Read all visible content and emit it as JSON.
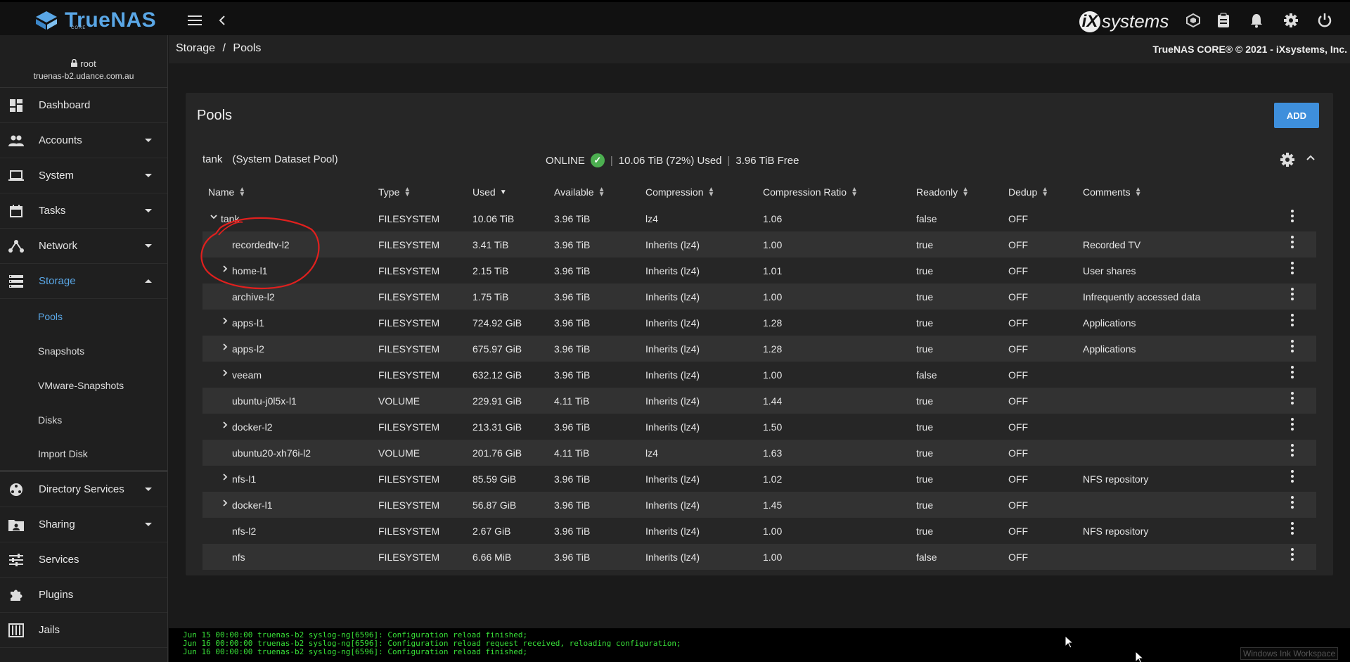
{
  "topbar": {
    "logo_text": "TrueNAS",
    "logo_sub": "CORE",
    "brand_text": "systems",
    "icons": [
      "menu-icon",
      "back-arrow-icon",
      "truecommand-icon",
      "clipboard-icon",
      "bell-icon",
      "gear-icon",
      "power-icon"
    ]
  },
  "user": {
    "name": "root",
    "host": "truenas-b2.udance.com.au"
  },
  "sidebar": {
    "items": [
      {
        "label": "Dashboard",
        "icon": "dashboard-icon",
        "caret": false
      },
      {
        "label": "Accounts",
        "icon": "accounts-icon",
        "caret": true
      },
      {
        "label": "System",
        "icon": "laptop-icon",
        "caret": true
      },
      {
        "label": "Tasks",
        "icon": "calendar-icon",
        "caret": true
      },
      {
        "label": "Network",
        "icon": "network-icon",
        "caret": true
      },
      {
        "label": "Storage",
        "icon": "storage-icon",
        "caret": true,
        "expanded": true,
        "active": true
      }
    ],
    "storage_sub": [
      "Pools",
      "Snapshots",
      "VMware-Snapshots",
      "Disks",
      "Import Disk"
    ],
    "items_after": [
      {
        "label": "Directory Services",
        "icon": "directory-icon",
        "caret": true
      },
      {
        "label": "Sharing",
        "icon": "sharing-icon",
        "caret": true
      },
      {
        "label": "Services",
        "icon": "tune-icon",
        "caret": false
      },
      {
        "label": "Plugins",
        "icon": "puzzle-icon",
        "caret": false
      },
      {
        "label": "Jails",
        "icon": "jail-icon",
        "caret": false
      }
    ]
  },
  "breadcrumb": {
    "parent": "Storage",
    "sep": "/",
    "current": "Pools"
  },
  "copyright": "TrueNAS CORE® © 2021 - iXsystems, Inc.",
  "card": {
    "title": "Pools",
    "add_label": "ADD"
  },
  "pool": {
    "name": "tank",
    "note": "(System Dataset Pool)",
    "status": "ONLINE",
    "used": "10.06 TiB (72%) Used",
    "free": "3.96 TiB Free"
  },
  "table": {
    "columns": [
      "Name",
      "Type",
      "Used",
      "Available",
      "Compression",
      "Compression Ratio",
      "Readonly",
      "Dedup",
      "Comments"
    ],
    "rows": [
      {
        "name": "tank",
        "type": "FILESYSTEM",
        "used": "10.06 TiB",
        "avail": "3.96 TiB",
        "comp": "lz4",
        "ratio": "1.06",
        "ro": "false",
        "dedup": "OFF",
        "comment": "",
        "expand": "down",
        "level": 0
      },
      {
        "name": "recordedtv-l2",
        "type": "FILESYSTEM",
        "used": "3.41 TiB",
        "avail": "3.96 TiB",
        "comp": "Inherits (lz4)",
        "ratio": "1.00",
        "ro": "true",
        "dedup": "OFF",
        "comment": "Recorded TV",
        "expand": "",
        "level": 1
      },
      {
        "name": "home-l1",
        "type": "FILESYSTEM",
        "used": "2.15 TiB",
        "avail": "3.96 TiB",
        "comp": "Inherits (lz4)",
        "ratio": "1.01",
        "ro": "true",
        "dedup": "OFF",
        "comment": "User shares",
        "expand": "right",
        "level": 1
      },
      {
        "name": "archive-l2",
        "type": "FILESYSTEM",
        "used": "1.75 TiB",
        "avail": "3.96 TiB",
        "comp": "Inherits (lz4)",
        "ratio": "1.00",
        "ro": "true",
        "dedup": "OFF",
        "comment": "Infrequently accessed data",
        "expand": "",
        "level": 1
      },
      {
        "name": "apps-l1",
        "type": "FILESYSTEM",
        "used": "724.92 GiB",
        "avail": "3.96 TiB",
        "comp": "Inherits (lz4)",
        "ratio": "1.28",
        "ro": "true",
        "dedup": "OFF",
        "comment": "Applications",
        "expand": "right",
        "level": 1
      },
      {
        "name": "apps-l2",
        "type": "FILESYSTEM",
        "used": "675.97 GiB",
        "avail": "3.96 TiB",
        "comp": "Inherits (lz4)",
        "ratio": "1.28",
        "ro": "true",
        "dedup": "OFF",
        "comment": "Applications",
        "expand": "right",
        "level": 1
      },
      {
        "name": "veeam",
        "type": "FILESYSTEM",
        "used": "632.12 GiB",
        "avail": "3.96 TiB",
        "comp": "Inherits (lz4)",
        "ratio": "1.00",
        "ro": "false",
        "dedup": "OFF",
        "comment": "",
        "expand": "right",
        "level": 1
      },
      {
        "name": "ubuntu-j0l5x-l1",
        "type": "VOLUME",
        "used": "229.91 GiB",
        "avail": "4.11 TiB",
        "comp": "Inherits (lz4)",
        "ratio": "1.44",
        "ro": "true",
        "dedup": "OFF",
        "comment": "",
        "expand": "",
        "level": 1
      },
      {
        "name": "docker-l2",
        "type": "FILESYSTEM",
        "used": "213.31 GiB",
        "avail": "3.96 TiB",
        "comp": "Inherits (lz4)",
        "ratio": "1.50",
        "ro": "true",
        "dedup": "OFF",
        "comment": "",
        "expand": "right",
        "level": 1
      },
      {
        "name": "ubuntu20-xh76i-l2",
        "type": "VOLUME",
        "used": "201.76 GiB",
        "avail": "4.11 TiB",
        "comp": "lz4",
        "ratio": "1.63",
        "ro": "true",
        "dedup": "OFF",
        "comment": "",
        "expand": "",
        "level": 1
      },
      {
        "name": "nfs-l1",
        "type": "FILESYSTEM",
        "used": "85.59 GiB",
        "avail": "3.96 TiB",
        "comp": "Inherits (lz4)",
        "ratio": "1.02",
        "ro": "true",
        "dedup": "OFF",
        "comment": "NFS repository",
        "expand": "right",
        "level": 1
      },
      {
        "name": "docker-l1",
        "type": "FILESYSTEM",
        "used": "56.87 GiB",
        "avail": "3.96 TiB",
        "comp": "Inherits (lz4)",
        "ratio": "1.45",
        "ro": "true",
        "dedup": "OFF",
        "comment": "",
        "expand": "right",
        "level": 1
      },
      {
        "name": "nfs-l2",
        "type": "FILESYSTEM",
        "used": "2.67 GiB",
        "avail": "3.96 TiB",
        "comp": "Inherits (lz4)",
        "ratio": "1.00",
        "ro": "true",
        "dedup": "OFF",
        "comment": "NFS repository",
        "expand": "",
        "level": 1
      },
      {
        "name": "nfs",
        "type": "FILESYSTEM",
        "used": "6.66 MiB",
        "avail": "3.96 TiB",
        "comp": "Inherits (lz4)",
        "ratio": "1.00",
        "ro": "false",
        "dedup": "OFF",
        "comment": "",
        "expand": "",
        "level": 1
      }
    ]
  },
  "console": [
    "Jun 15 00:00:00 truenas-b2 syslog-ng[6596]: Configuration reload finished;",
    "Jun 16 00:00:00 truenas-b2 syslog-ng[6596]: Configuration reload request received, reloading configuration;",
    "Jun 16 00:00:00 truenas-b2 syslog-ng[6596]: Configuration reload finished;"
  ],
  "ink_label": "Windows Ink Workspace",
  "colors": {
    "accent": "#5aa7e6",
    "button": "#3e8fdc",
    "online": "#4caf50",
    "console": "#38e038",
    "annotation": "#e0201e"
  }
}
